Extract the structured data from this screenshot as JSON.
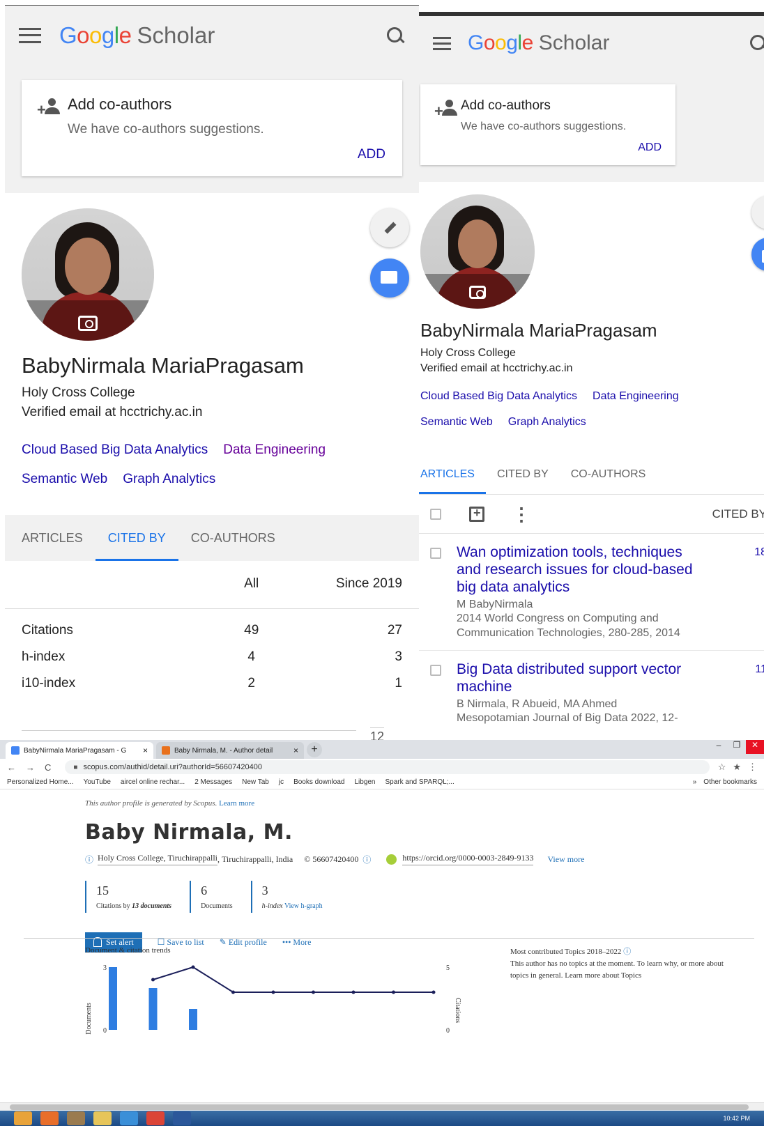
{
  "left": {
    "logo": {
      "g": "G",
      "o1": "o",
      "o2": "o",
      "g2": "g",
      "l": "l",
      "e": "e",
      "scholar": "Scholar"
    },
    "coauthors": {
      "title": "Add co-authors",
      "subtitle": "We have co-authors suggestions.",
      "action": "ADD"
    },
    "profile": {
      "name": "BabyNirmala MariaPragasam",
      "affiliation": "Holy Cross College",
      "email": "Verified email at hcctrichy.ac.in"
    },
    "interests": [
      "Cloud Based Big Data Analytics",
      "Data Engineering",
      "Semantic Web",
      "Graph Analytics"
    ],
    "tabs": [
      "ARTICLES",
      "CITED BY",
      "CO-AUTHORS"
    ],
    "active_tab": "CITED BY",
    "table": {
      "headers": [
        "",
        "All",
        "Since 2019"
      ],
      "rows": [
        {
          "label": "Citations",
          "all": "49",
          "since": "27"
        },
        {
          "label": "h-index",
          "all": "4",
          "since": "3"
        },
        {
          "label": "i10-index",
          "all": "2",
          "since": "1"
        }
      ],
      "chart_partial": "12"
    }
  },
  "right": {
    "logo": {
      "scholar": "Scholar"
    },
    "coauthors": {
      "title": "Add co-authors",
      "subtitle": "We have co-authors suggestions.",
      "action": "ADD"
    },
    "profile": {
      "name": "BabyNirmala MariaPragasam",
      "affiliation": "Holy Cross College",
      "email": "Verified email at hcctrichy.ac.in"
    },
    "interests": [
      "Cloud Based Big Data Analytics",
      "Data Engineering",
      "Semantic Web",
      "Graph Analytics"
    ],
    "tabs": [
      "ARTICLES",
      "CITED BY",
      "CO-AUTHORS"
    ],
    "active_tab": "ARTICLES",
    "toolbar": {
      "cited_by": "CITED BY"
    },
    "articles": [
      {
        "title": "Wan optimization tools, techniques and research issues for cloud-based big data analytics",
        "authors": "M BabyNirmala",
        "venue": "2014 World Congress on Computing and Communication Technologies, 280-285, 2014",
        "cited": "18"
      },
      {
        "title": "Big Data distributed support vector machine",
        "authors": "B Nirmala, R Abueid, MA Ahmed",
        "venue": "Mesopotamian Journal of Big Data 2022, 12-",
        "cited": "11"
      }
    ]
  },
  "browser": {
    "tabs": [
      {
        "label": "BabyNirmala MariaPragasam - G",
        "close": "×",
        "color": "#4285f4"
      },
      {
        "label": "Baby Nirmala, M. - Author detail",
        "close": "×",
        "color": "#e9711c"
      }
    ],
    "new_tab": "+",
    "url": "scopus.com/authid/detail.uri?authorId=56607420400",
    "bookmarks": [
      "Personalized Home...",
      "YouTube",
      "aircel online rechar...",
      "2 Messages",
      "New Tab",
      "jc",
      "Books download",
      "Libgen",
      "Spark and SPARQL;..."
    ],
    "bookmarks_more": "»",
    "other_bookmarks": "Other bookmarks",
    "window_controls": {
      "minimize": "–",
      "maximize": "❐",
      "close": "✕"
    }
  },
  "scopus": {
    "note": "This author profile is generated by Scopus.",
    "learn_more": "Learn more",
    "name": "Baby Nirmala, M.",
    "affiliation": "Holy Cross College, Tiruchirappalli",
    "location": "Tiruchirappalli, India",
    "author_id": "56607420400",
    "orcid": "https://orcid.org/0000-0003-2849-9133",
    "view_more": "View more",
    "metrics": [
      {
        "value": "15",
        "label": "Citations by",
        "label_bold": "13 documents",
        "link": ""
      },
      {
        "value": "6",
        "label": "Documents",
        "label_bold": "",
        "link": ""
      },
      {
        "value": "3",
        "label": "h-index",
        "label_bold": "",
        "link": "View h-graph"
      }
    ],
    "actions": {
      "alert": "Set alert",
      "save": "Save to list",
      "edit": "Edit profile",
      "more": "More"
    },
    "trends": {
      "title": "Document & citation trends",
      "left_axis": "Documents",
      "right_axis": "Citations"
    },
    "topics": {
      "title": "Most contributed Topics 2018–2022",
      "text": "This author has no topics at the moment. To learn why, or more about topics in general. Learn more about Topics"
    }
  },
  "chart_data": {
    "type": "bar",
    "title": "Document & citation trends",
    "ylabel": "Documents",
    "y2label": "Citations",
    "ylim": [
      0,
      3
    ],
    "y2lim": [
      0,
      5
    ],
    "documents": [
      3,
      2,
      1,
      0,
      0,
      0,
      0,
      0,
      0
    ],
    "citations": [
      null,
      4,
      5,
      3,
      3,
      3,
      3,
      3,
      3
    ]
  },
  "taskbar": {
    "time": "10:42 PM"
  }
}
